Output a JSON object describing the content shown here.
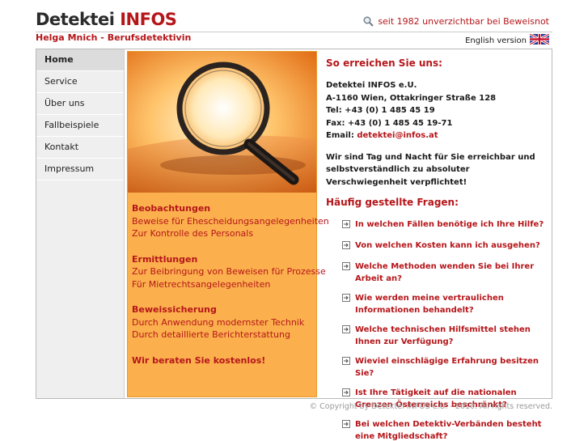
{
  "header": {
    "logo_main": "Detektei",
    "logo_accent": "INFOS",
    "tagline": "seit 1982 unverzichtbar bei Beweisnot",
    "subtitle": "Helga Mnich - Berufsdetektivin",
    "language_link": "English version"
  },
  "nav": {
    "items": [
      {
        "label": "Home"
      },
      {
        "label": "Service"
      },
      {
        "label": "Über uns"
      },
      {
        "label": "Fallbeispiele"
      },
      {
        "label": "Kontakt"
      },
      {
        "label": "Impressum"
      }
    ]
  },
  "services": {
    "groups": [
      {
        "head": "Beobachtungen",
        "lines": [
          "Beweise für Ehescheidungsangelegenheiten",
          "Zur Kontrolle des Personals"
        ]
      },
      {
        "head": "Ermittlungen",
        "lines": [
          "Zur Beibringung von Beweisen für Prozesse",
          "Für Mietrechtsangelegenheiten"
        ]
      },
      {
        "head": "Beweissicherung",
        "lines": [
          "Durch Anwendung modernster Technik",
          "Durch detaillierte Berichterstattung"
        ]
      }
    ],
    "cta": "Wir beraten Sie kostenlos!"
  },
  "contact": {
    "title": "So erreichen Sie uns:",
    "company": "Detektei INFOS e.U.",
    "address": "A-1160 Wien, Ottakringer Straße 128",
    "tel": "Tel: +43 (0) 1 485 45 19",
    "fax": "Fax: +43 (0) 1 485 45 19-71",
    "email_label": "Email:",
    "email": "detektei@infos.at",
    "availability": "Wir sind Tag und Nacht für Sie erreichbar und selbstverständlich zu absoluter Verschwiegenheit verpflichtet!"
  },
  "faq": {
    "title": "Häufig gestellte Fragen:",
    "items": [
      "In welchen Fällen benötige ich Ihre Hilfe?",
      "Von welchen Kosten kann ich ausgehen?",
      "Welche Methoden wenden Sie bei Ihrer Arbeit an?",
      "Wie werden meine vertraulichen Informationen behandelt?",
      "Welche technischen Hilfsmittel stehen Ihnen zur Verfügung?",
      "Wieviel einschlägige Erfahrung besitzen Sie?",
      "Ist Ihre Tätigkeit auf die nationalen Grenzen Österreichs beschränkt?",
      "Bei welchen Detektiv-Verbänden besteht eine Mitgliedschaft?"
    ]
  },
  "footer": {
    "copyright": "© Copyright by Detektei INFOS e.U. - 2010. All rights reserved."
  },
  "colors": {
    "brand_red": "#b5161a",
    "orange_panel": "#fbb04d",
    "sidebar_bg": "#efefef"
  },
  "icons": {
    "tagline": "magnifier-icon",
    "language": "uk-flag-icon",
    "faq": "arrow-box-icon"
  }
}
